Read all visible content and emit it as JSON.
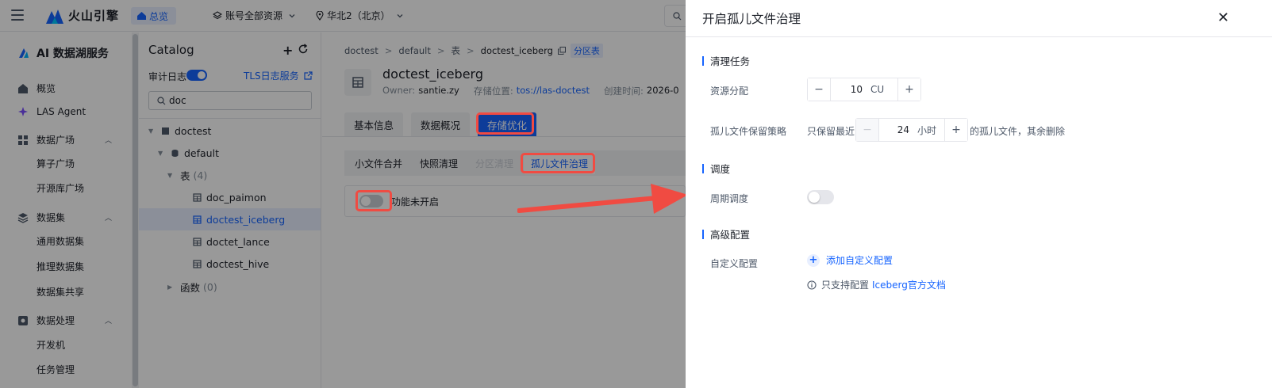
{
  "topbar": {
    "brand": "火山引擎",
    "home": "总览",
    "account_scope": "账号全部资源",
    "region": "华北2（北京）"
  },
  "nav": {
    "product": "AI 数据湖服务",
    "overview": "概览",
    "agent": "LAS Agent",
    "data_market": "数据广场",
    "operator_market": "算子广场",
    "repo_market": "开源库广场",
    "datasets": "数据集",
    "general_datasets": "通用数据集",
    "inference_datasets": "推理数据集",
    "dataset_share": "数据集共享",
    "data_processing": "数据处理",
    "dev_machine": "开发机",
    "task_management": "任务管理"
  },
  "catalog": {
    "title": "Catalog",
    "audit_log": "审计日志",
    "tls_service": "TLS日志服务",
    "search_value": "doc",
    "tree": {
      "db": "doctest",
      "schema": "default",
      "tables_label": "表",
      "tables_count": "(4)",
      "tables": [
        "doc_paimon",
        "doctest_iceberg",
        "doctet_lance",
        "doctest_hive"
      ],
      "functions_label": "函数",
      "functions_count": "(0)"
    }
  },
  "main": {
    "breadcrumb": [
      "doctest",
      "default",
      "表",
      "doctest_iceberg"
    ],
    "partition_tag": "分区表",
    "table_name": "doctest_iceberg",
    "owner_label": "Owner:",
    "owner": "santie.zy",
    "storage_label": "存储位置:",
    "storage": "tos://las-doctest",
    "created_label": "创建时间:",
    "created": "2026-0",
    "tabs": [
      "基本信息",
      "数据概况",
      "存储优化"
    ],
    "subtabs": [
      "小文件合并",
      "快照清理",
      "分区清理",
      "孤儿文件治理"
    ],
    "feature_status": "功能未开启"
  },
  "drawer": {
    "title": "开启孤儿文件治理",
    "sec_cleanup": "清理任务",
    "resource_label": "资源分配",
    "resource_value": "10",
    "resource_unit": "CU",
    "retain_label": "孤儿文件保留策略",
    "retain_prefix": "只保留最近",
    "retain_value": "24",
    "retain_unit": "小时",
    "retain_suffix": "的孤儿文件，其余删除",
    "sec_schedule": "调度",
    "periodic_label": "周期调度",
    "sec_advanced": "高级配置",
    "custom_label": "自定义配置",
    "add_custom": "添加自定义配置",
    "hint_prefix": "只支持配置",
    "hint_link": "Iceberg官方文档"
  },
  "colors": {
    "accent": "#1664ff",
    "highlight": "#f04b42"
  }
}
